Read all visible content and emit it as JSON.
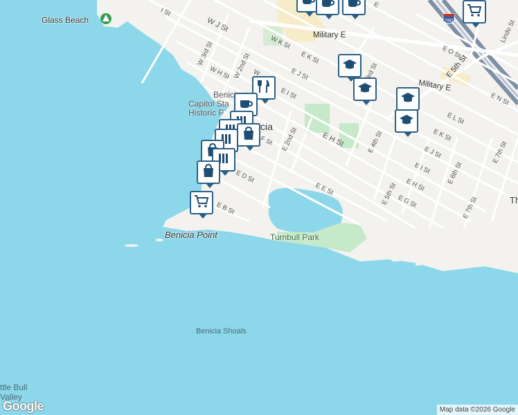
{
  "map": {
    "places": {
      "glass_beach": "Glass Beach",
      "benicia_point": "Benicia Point",
      "turnbull_park": "Turnbull Park",
      "benicia_shoals": "Benicia Shoals",
      "benicia_partial": "Benicia",
      "capitol_partial_1": "Capitol Sta",
      "capitol_partial_2": "Historic P",
      "city_partial": "cia",
      "edge_label": "Th",
      "bull_partial_1": "ttle Bull",
      "bull_partial_2": "Valley"
    },
    "streets": {
      "i_st": "I St",
      "w_j_st": "W J St",
      "w_k_st": "W K St",
      "w_3rd_st": "W 3rd St",
      "w_2nd_st": "W 2nd St",
      "w_h_st": "W H St",
      "w_partial": "W",
      "e_k_st": "E K St",
      "e_j_st": "E J St",
      "e_i_st": "E I St",
      "e_h_st": "E H St",
      "e_f_st_partial": "F St",
      "e_2nd_st": "E 2nd St",
      "e_d_st": "E D St",
      "e_b_st": "E B St",
      "e_e_st": "E E St",
      "e_4th_st": "E 4th St",
      "e_5th_st": "E 5th St",
      "e_6th_st": "E 6th St",
      "e_7th_st": "E 7th St",
      "e_7th_st_b": "E 7th St",
      "e_l_st": "E L St",
      "e_k_st_b": "E K St",
      "e_j_st_b": "E J St",
      "e_i_st_b": "E I St",
      "e_h_st_b": "E H St",
      "e_g_st": "E G St",
      "e_o_st": "E O St",
      "e_n_st": "E N St",
      "military_e": "Military E",
      "military_e_2": "Military E",
      "e_5th_st_main": "E 5th St",
      "lindo_st": "Lindo St",
      "third_partial": "3rd St",
      "e_partial": "E"
    },
    "highway": {
      "shield": "780"
    },
    "attribution": "Map data ©2026 Google",
    "logo": "Google",
    "colors": {
      "water": "#8cd8ea",
      "land": "#f3f2ef",
      "park": "#c6e9c9",
      "marker_border": "#2b5f86",
      "highway": "#7e8fa6"
    },
    "markers": [
      {
        "icon": "cafe-icon"
      },
      {
        "icon": "restaurant-icon"
      },
      {
        "icon": "school-icon"
      },
      {
        "icon": "school-icon"
      },
      {
        "icon": "school-icon"
      },
      {
        "icon": "school-icon"
      },
      {
        "icon": "grocery-icon"
      },
      {
        "icon": "grocery-icon"
      },
      {
        "icon": "shopping-icon"
      },
      {
        "icon": "shopping-icon"
      },
      {
        "icon": "cafe-icon"
      },
      {
        "icon": "bar-icon"
      }
    ]
  }
}
